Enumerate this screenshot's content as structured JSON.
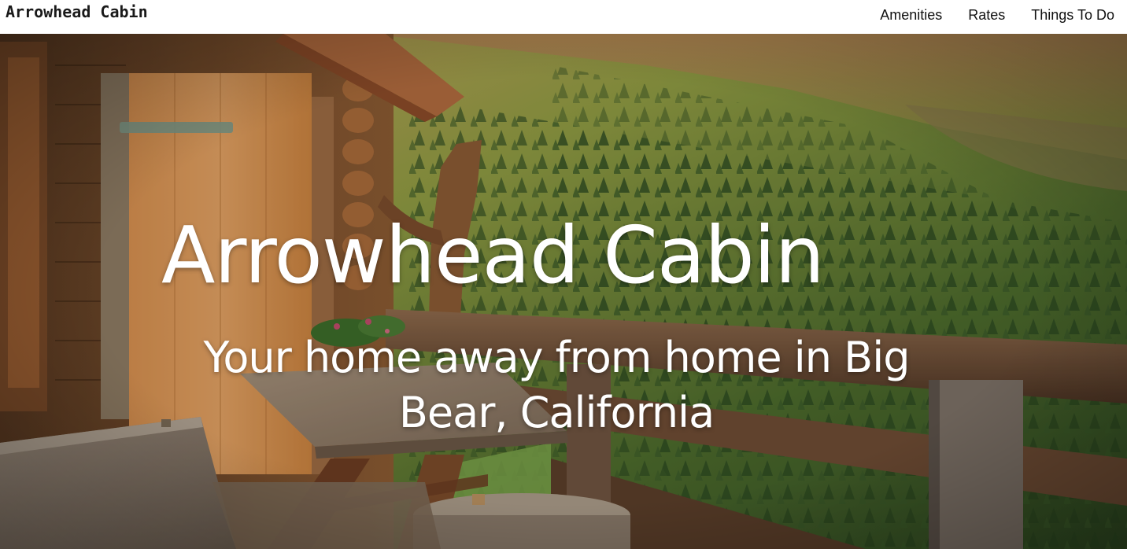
{
  "navbar": {
    "brand": "Arrowhead Cabin",
    "links": [
      {
        "label": "Amenities"
      },
      {
        "label": "Rates"
      },
      {
        "label": "Things To Do"
      }
    ]
  },
  "hero": {
    "title": "Arrowhead Cabin",
    "subtitle": "Your home away from home in Big Bear, California",
    "image_description_icon": "cabin-porch-mountain-photo"
  },
  "colors": {
    "nav_background": "#ffffff",
    "nav_text": "#111111",
    "hero_text": "#ffffff"
  }
}
